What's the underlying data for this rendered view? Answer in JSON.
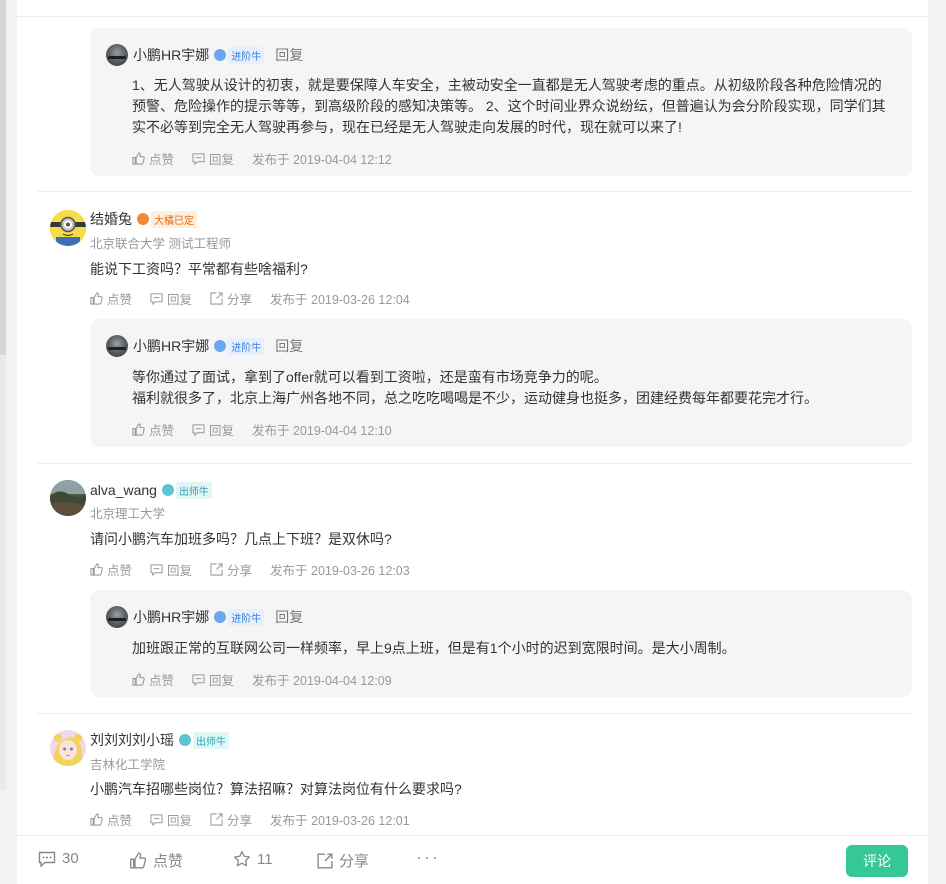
{
  "reply_author": {
    "name": "小鹏HR宇娜",
    "badge": "进阶牛",
    "reply_label": "回复"
  },
  "action_labels": {
    "like": "点赞",
    "reply": "回复",
    "share": "分享"
  },
  "replies": [
    {
      "text": "1、无人驾驶从设计的初衷，就是要保障人车安全，主被动安全一直都是无人驾驶考虑的重点。从初级阶段各种危险情况的预警、危险操作的提示等等，到高级阶段的感知决策等。 2、这个时间业界众说纷纭，但普遍认为会分阶段实现，同学们其实不必等到完全无人驾驶再参与，现在已经是无人驾驶走向发展的时代，现在就可以来了!",
      "time": "发布于 2019-04-04 12:12"
    },
    {
      "text": "等你通过了面试，拿到了offer就可以看到工资啦，还是蛮有市场竞争力的呢。\n福利就很多了，北京上海广州各地不同，总之吃吃喝喝是不少，运动健身也挺多，团建经费每年都要花完才行。",
      "time": "发布于 2019-04-04 12:10"
    },
    {
      "text": "加班跟正常的互联网公司一样频率，早上9点上班，但是有1个小时的迟到宽限时间。是大小周制。",
      "time": "发布于 2019-04-04 12:09"
    }
  ],
  "comments": [
    {
      "name": "结婚兔",
      "badge": "大橘已定",
      "subtitle": "北京联合大学 测试工程师",
      "text": "能说下工资吗？平常都有些啥福利?",
      "time": "发布于 2019-03-26 12:04"
    },
    {
      "name": "alva_wang",
      "badge": "出师牛",
      "subtitle": "北京理工大学",
      "text": "请问小鹏汽车加班多吗？几点上下班？是双休吗?",
      "time": "发布于 2019-03-26 12:03"
    },
    {
      "name": "刘刘刘刘小瑶",
      "badge": "出师牛",
      "subtitle": "吉林化工学院",
      "text": "小鹏汽车招哪些岗位？算法招嘛？对算法岗位有什么要求吗?",
      "time": "发布于 2019-03-26 12:01"
    }
  ],
  "footer": {
    "comment_count": "30",
    "like_label": "点赞",
    "star_count": "11",
    "share_label": "分享",
    "more": "···",
    "comment_button": "评论"
  },
  "colors": {
    "accent": "#36c797",
    "badge_blue": "#3a7fdb",
    "badge_teal": "#2ba6b3",
    "badge_orange": "#e26a14"
  }
}
